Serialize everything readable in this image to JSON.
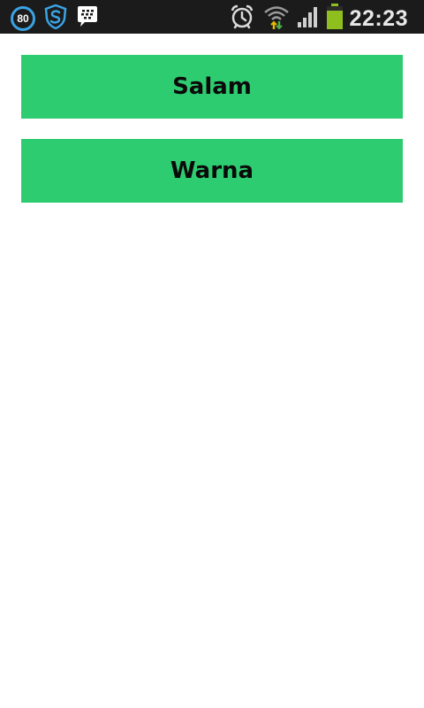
{
  "status_bar": {
    "badge_count": "80",
    "time": "22:23",
    "icons": [
      "eighty-badge-icon",
      "shield-s-icon",
      "bbm-chat-icon",
      "alarm-icon",
      "wifi-icon",
      "signal-icon",
      "battery-icon"
    ],
    "accent_blue": "#3aa3e3",
    "battery_color": "#8fbf1f"
  },
  "menu": {
    "buttons": [
      {
        "label": "Salam"
      },
      {
        "label": "Warna"
      }
    ],
    "button_color": "#2ecc71"
  }
}
